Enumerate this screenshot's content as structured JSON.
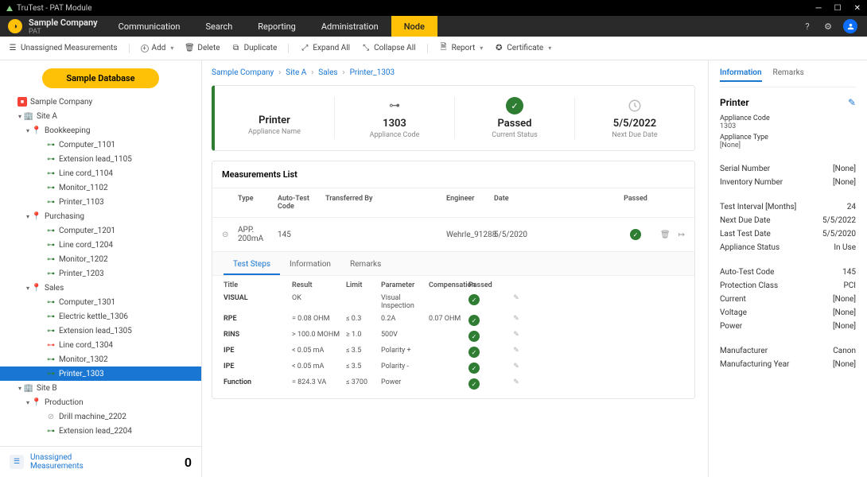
{
  "window": {
    "title": "TruTest - PAT Module"
  },
  "header": {
    "company": "Sample Company",
    "module": "PAT",
    "nav": [
      "Communication",
      "Search",
      "Reporting",
      "Administration",
      "Node"
    ],
    "activeNav": 4
  },
  "toolbar": {
    "unassigned": "Unassigned Measurements",
    "add": "Add",
    "delete": "Delete",
    "duplicate": "Duplicate",
    "expand": "Expand All",
    "collapse": "Collapse All",
    "report": "Report",
    "certificate": "Certificate"
  },
  "sidebar": {
    "dbButton": "Sample Database",
    "root": "Sample Company",
    "footer": {
      "label1": "Unassigned",
      "label2": "Measurements",
      "count": "0"
    }
  },
  "tree": [
    {
      "pad": 12,
      "tog": "",
      "kind": "company",
      "label": "Sample Company"
    },
    {
      "pad": 20,
      "tog": "▾",
      "kind": "site",
      "label": "Site A"
    },
    {
      "pad": 30,
      "tog": "▾",
      "kind": "loc",
      "label": "Bookkeeping"
    },
    {
      "pad": 48,
      "tog": "",
      "kind": "appl-g",
      "label": "Computer_1101"
    },
    {
      "pad": 48,
      "tog": "",
      "kind": "appl-g",
      "label": "Extension lead_1105"
    },
    {
      "pad": 48,
      "tog": "",
      "kind": "appl-g",
      "label": "Line cord_1104"
    },
    {
      "pad": 48,
      "tog": "",
      "kind": "appl-g",
      "label": "Monitor_1102"
    },
    {
      "pad": 48,
      "tog": "",
      "kind": "appl-g",
      "label": "Printer_1103"
    },
    {
      "pad": 30,
      "tog": "▾",
      "kind": "loc",
      "label": "Purchasing"
    },
    {
      "pad": 48,
      "tog": "",
      "kind": "appl-g",
      "label": "Computer_1201"
    },
    {
      "pad": 48,
      "tog": "",
      "kind": "appl-g",
      "label": "Line cord_1204"
    },
    {
      "pad": 48,
      "tog": "",
      "kind": "appl-g",
      "label": "Monitor_1202"
    },
    {
      "pad": 48,
      "tog": "",
      "kind": "appl-g",
      "label": "Printer_1203"
    },
    {
      "pad": 30,
      "tog": "▾",
      "kind": "loc",
      "label": "Sales"
    },
    {
      "pad": 48,
      "tog": "",
      "kind": "appl-g",
      "label": "Computer_1301"
    },
    {
      "pad": 48,
      "tog": "",
      "kind": "appl-g",
      "label": "Electric kettle_1306"
    },
    {
      "pad": 48,
      "tog": "",
      "kind": "appl-g",
      "label": "Extension lead_1305"
    },
    {
      "pad": 48,
      "tog": "",
      "kind": "appl-r",
      "label": "Line cord_1304"
    },
    {
      "pad": 48,
      "tog": "",
      "kind": "appl-g",
      "label": "Monitor_1302"
    },
    {
      "pad": 48,
      "tog": "",
      "kind": "appl-g",
      "label": "Printer_1303",
      "selected": true
    },
    {
      "pad": 20,
      "tog": "▾",
      "kind": "site",
      "label": "Site B"
    },
    {
      "pad": 30,
      "tog": "▾",
      "kind": "loc",
      "label": "Production"
    },
    {
      "pad": 48,
      "tog": "",
      "kind": "disabled",
      "label": "Drill machine_2202"
    },
    {
      "pad": 48,
      "tog": "",
      "kind": "appl-g",
      "label": "Extension lead_2204"
    }
  ],
  "crumbs": [
    "Sample Company",
    "Site A",
    "Sales",
    "Printer_1303"
  ],
  "summary": {
    "name": {
      "value": "Printer",
      "label": "Appliance Name"
    },
    "code": {
      "value": "1303",
      "label": "Appliance Code"
    },
    "status": {
      "value": "Passed",
      "label": "Current Status"
    },
    "next": {
      "value": "5/5/2022",
      "label": "Next Due Date"
    }
  },
  "measList": {
    "title": "Measurements List",
    "cols": {
      "type": "Type",
      "atc": "Auto-Test Code",
      "trans": "Transferred By",
      "eng": "Engineer",
      "date": "Date",
      "pass": "Passed"
    },
    "row": {
      "type": "APP. 200mA",
      "atc": "145",
      "trans": "",
      "eng": "Wehrle_91288",
      "date": "5/5/2020"
    },
    "tabs": [
      "Test Steps",
      "Information",
      "Remarks"
    ],
    "activeTab": 0,
    "stepCols": {
      "title": "Title",
      "result": "Result",
      "limit": "Limit",
      "param": "Parameter",
      "comp": "Compensation",
      "pass": "Passed"
    },
    "steps": [
      {
        "title": "VISUAL",
        "result": "OK",
        "limit": "",
        "param": "Visual Inspection",
        "comp": ""
      },
      {
        "title": "RPE",
        "result": "= 0.08 OHM",
        "limit": "≤ 0.3",
        "param": "0.2A",
        "comp": "0.07 OHM"
      },
      {
        "title": "RINS",
        "result": "> 100.0 MOHM",
        "limit": "≥ 1.0",
        "param": "500V",
        "comp": ""
      },
      {
        "title": "IPE",
        "result": "< 0.05 mA",
        "limit": "≤ 3.5",
        "param": "Polarity +",
        "comp": ""
      },
      {
        "title": "IPE",
        "result": "< 0.05 mA",
        "limit": "≤ 3.5",
        "param": "Polarity -",
        "comp": ""
      },
      {
        "title": "Function",
        "result": "= 824.3 VA",
        "limit": "≤ 3700",
        "param": "Power",
        "comp": ""
      }
    ]
  },
  "info": {
    "tabs": [
      "Information",
      "Remarks"
    ],
    "activeTab": 0,
    "title": "Printer",
    "block1": [
      {
        "k": "Appliance Code",
        "v": "1303"
      },
      {
        "k": "Appliance Type",
        "v": "[None]"
      }
    ],
    "rows1": [
      {
        "k": "Serial Number",
        "v": "[None]"
      },
      {
        "k": "Inventory Number",
        "v": "[None]"
      }
    ],
    "rows2": [
      {
        "k": "Test Interval [Months]",
        "v": "24"
      },
      {
        "k": "Next Due Date",
        "v": "5/5/2022"
      },
      {
        "k": "Last Test Date",
        "v": "5/5/2020"
      },
      {
        "k": "Appliance Status",
        "v": "In Use"
      }
    ],
    "rows3": [
      {
        "k": "Auto-Test Code",
        "v": "145"
      },
      {
        "k": "Protection Class",
        "v": "PCI"
      },
      {
        "k": "Current",
        "v": "[None]"
      },
      {
        "k": "Voltage",
        "v": "[None]"
      },
      {
        "k": "Power",
        "v": "[None]"
      }
    ],
    "rows4": [
      {
        "k": "Manufacturer",
        "v": "Canon"
      },
      {
        "k": "Manufacturing Year",
        "v": "[None]"
      }
    ]
  }
}
